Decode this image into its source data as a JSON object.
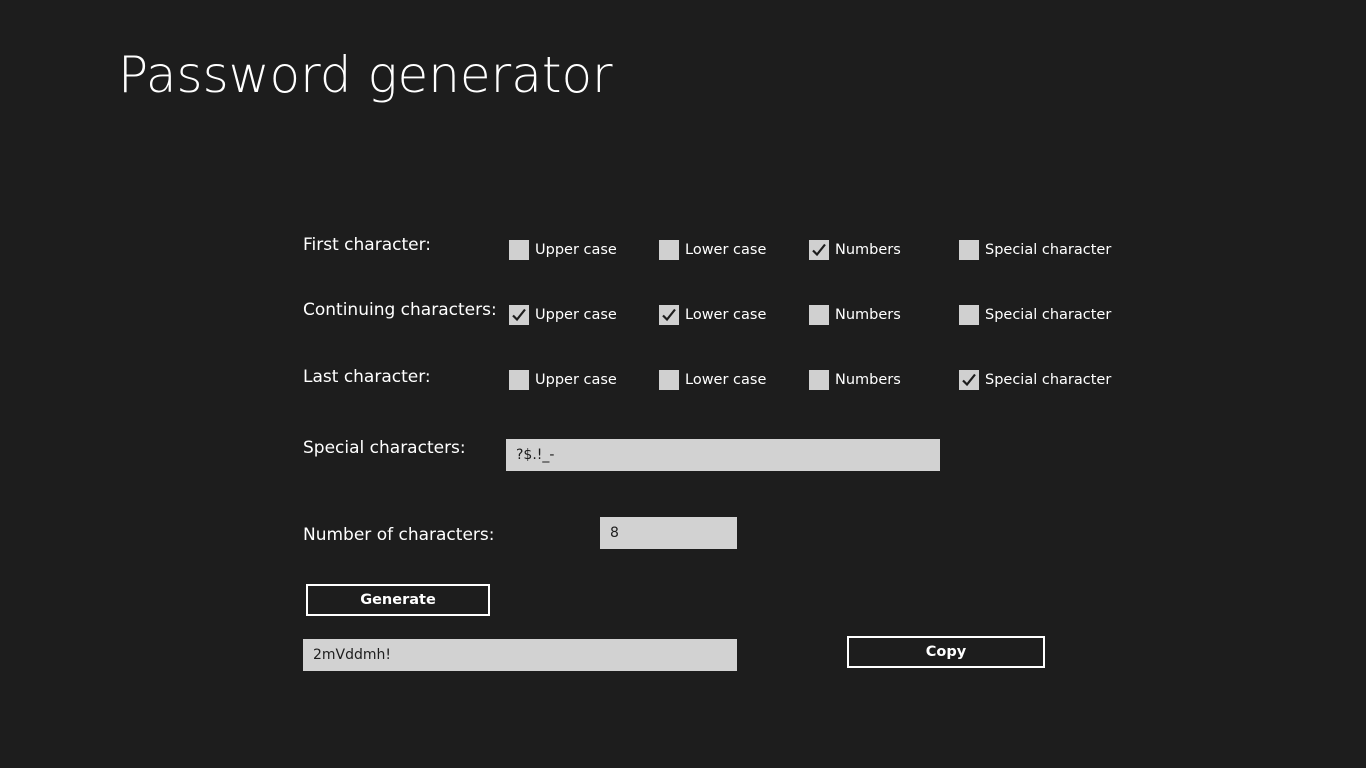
{
  "app": {
    "title": "Password generator"
  },
  "rows": [
    {
      "label": "First character:",
      "options": [
        {
          "label": "Upper case",
          "checked": false
        },
        {
          "label": "Lower case",
          "checked": false
        },
        {
          "label": "Numbers",
          "checked": true
        },
        {
          "label": "Special character",
          "checked": false
        }
      ]
    },
    {
      "label": "Continuing characters:",
      "options": [
        {
          "label": "Upper case",
          "checked": true
        },
        {
          "label": "Lower case",
          "checked": true
        },
        {
          "label": "Numbers",
          "checked": false
        },
        {
          "label": "Special character",
          "checked": false
        }
      ]
    },
    {
      "label": "Last character:",
      "options": [
        {
          "label": "Upper case",
          "checked": false
        },
        {
          "label": "Lower case",
          "checked": false
        },
        {
          "label": "Numbers",
          "checked": false
        },
        {
          "label": "Special character",
          "checked": true
        }
      ]
    }
  ],
  "special_characters": {
    "label": "Special characters:",
    "value": "?$.!_-"
  },
  "number_of_characters": {
    "label": "Number of characters:",
    "value": "8"
  },
  "generate_button": {
    "label": "Generate"
  },
  "result": {
    "value": "2mVddmh!"
  },
  "copy_button": {
    "label": "Copy"
  },
  "colors": {
    "background": "#1d1d1d",
    "text": "#ffffff",
    "input_background": "#d2d2d2",
    "checkbox_fill": "#d0d0d0",
    "checkmark": "#1d1d1d"
  }
}
